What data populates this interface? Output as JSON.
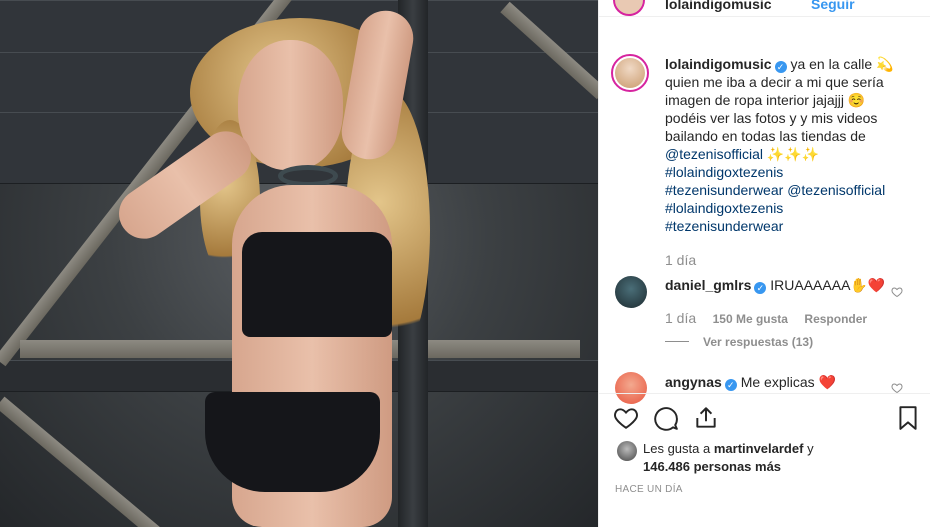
{
  "post": {
    "author": "lolaindigomusic",
    "follow_label": "Seguir",
    "caption_text": "ya en la calle 💫 quien me iba a decir a mi que sería imagen de ropa interior jajajjj ☺️ podéis ver las fotos y y mis videos bailando en todas las tiendas de",
    "caption_mention": "@tezenisofficial",
    "caption_sparkles": "✨✨✨",
    "caption_tags_1": "#lolaindigoxtezenis",
    "caption_tags_2": "#tezenisunderwear",
    "caption_mention_2": "@tezenisofficial",
    "caption_tags_3": "#lolaindigoxtezenis",
    "caption_tags_4": "#tezenisunderwear",
    "caption_time": "1 día"
  },
  "comments": [
    {
      "user": "daniel_gmlrs",
      "text": "IRUAAAAAA✋❤️",
      "time": "1 día",
      "likes": "150 Me gusta",
      "reply_label": "Responder",
      "view_replies": "Ver respuestas (13)"
    },
    {
      "user": "angynas",
      "text": "Me explicas ❤️"
    }
  ],
  "likes": {
    "prefix": "Les gusta a",
    "user": "martinvelardef",
    "joiner": "y",
    "count": "146.486 personas más"
  },
  "timestamp": "HACE UN DÍA",
  "colors": {
    "accent": "#3897f0",
    "link": "#00376b",
    "heart": "#ed4956"
  },
  "icons": [
    "heart-icon",
    "comment-icon",
    "share-icon",
    "bookmark-icon",
    "verified-icon"
  ]
}
